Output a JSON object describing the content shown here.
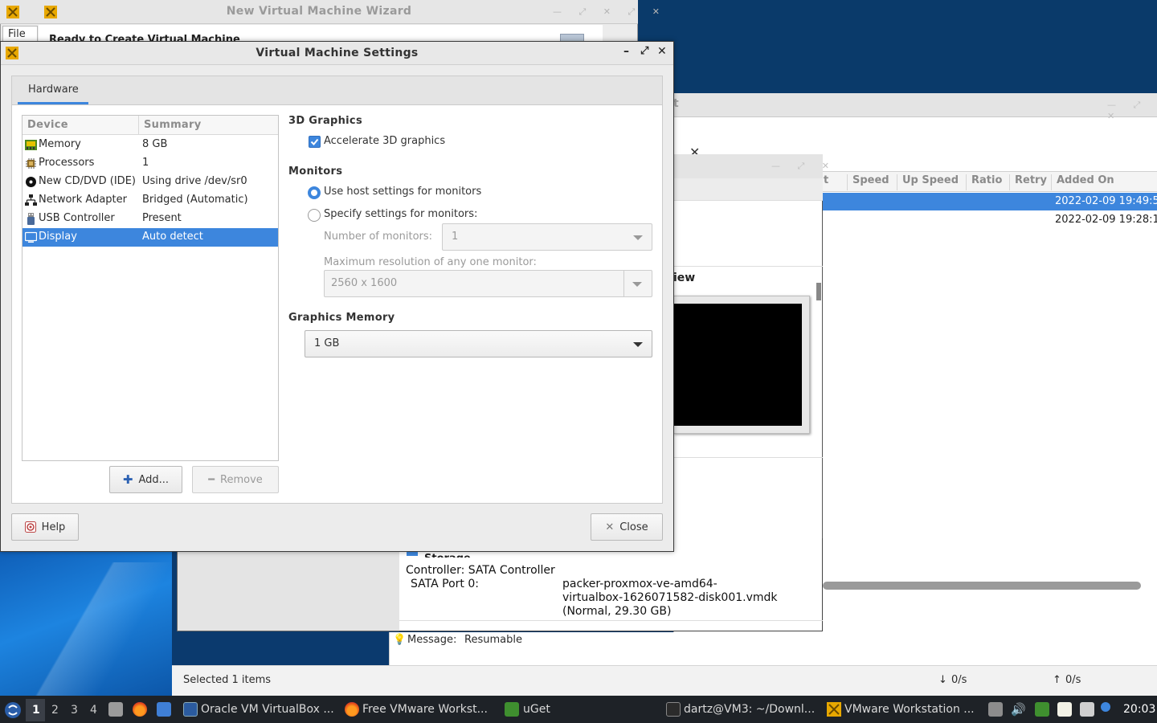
{
  "wizard": {
    "title": "New Virtual Machine Wizard",
    "menu_file": "File",
    "heading": "Ready to Create Virtual Machine"
  },
  "dialog": {
    "title": "Virtual Machine Settings",
    "tab_hardware": "Hardware",
    "device_col": "Device",
    "summary_col": "Summary",
    "devices": [
      {
        "name": "Memory",
        "summary": "8 GB",
        "icon": "memory-icon"
      },
      {
        "name": "Processors",
        "summary": "1",
        "icon": "processor-icon"
      },
      {
        "name": "New CD/DVD (IDE)",
        "summary": "Using drive /dev/sr0",
        "icon": "cd-icon"
      },
      {
        "name": "Network Adapter",
        "summary": "Bridged (Automatic)",
        "icon": "network-icon"
      },
      {
        "name": "USB Controller",
        "summary": "Present",
        "icon": "usb-icon"
      },
      {
        "name": "Display",
        "summary": "Auto detect",
        "icon": "display-icon"
      }
    ],
    "selected_device": "Display",
    "add_label": "Add...",
    "remove_label": "Remove",
    "help_label": "Help",
    "close_label": "Close",
    "graphics3d": {
      "title": "3D Graphics",
      "accelerate_label": "Accelerate 3D graphics",
      "accelerate_checked": true
    },
    "monitors": {
      "title": "Monitors",
      "use_host_label": "Use host settings for monitors",
      "specify_label": "Specify settings for monitors:",
      "selected": "use_host",
      "num_label": "Number of monitors:",
      "num_value": "1",
      "res_label": "Maximum resolution of any one monitor:",
      "res_value": "2560 x 1600"
    },
    "graphics_memory": {
      "title": "Graphics Memory",
      "value": "1 GB"
    }
  },
  "uget": {
    "title_fragment": "t",
    "columns": [
      "t",
      "Speed",
      "Up Speed",
      "Ratio",
      "Retry",
      "Added On"
    ],
    "rows": [
      {
        "added_on": "2022-02-09 19:49:5",
        "selected": true
      },
      {
        "added_on": "2022-02-09 19:28:1",
        "selected": false
      }
    ],
    "status": {
      "selected": "Selected 1 items",
      "down": "0/s",
      "up": "0/s"
    }
  },
  "virtualbox": {
    "preview_fragment": "iew",
    "storage_title": "Storage",
    "controller": "Controller: SATA Controller",
    "port_label": "SATA Port 0:",
    "port_value_1": "packer-proxmox-ve-amd64-",
    "port_value_2": "virtualbox-1626071582-disk001.vmdk",
    "port_value_3": "(Normal, 29.30 GB)",
    "message_label": "Message:",
    "message_value": "Resumable"
  },
  "taskbar": {
    "workspaces": [
      "1",
      "2",
      "3",
      "4"
    ],
    "active_workspace": "1",
    "apps": [
      {
        "label": "Oracle VM VirtualBox ...",
        "icon": "virtualbox-icon"
      },
      {
        "label": "Free VMware Workst...",
        "icon": "firefox-icon"
      },
      {
        "label": "uGet",
        "icon": "uget-icon"
      },
      {
        "label": "dartz@VM3: ~/Downl...",
        "icon": "terminal-icon"
      },
      {
        "label": "VMware Workstation ...",
        "icon": "vmware-icon"
      }
    ],
    "clock": "20:03"
  },
  "colors": {
    "accent": "#3d86dd",
    "taskbar": "#1e2227",
    "desktop": "#0b3a6e"
  }
}
